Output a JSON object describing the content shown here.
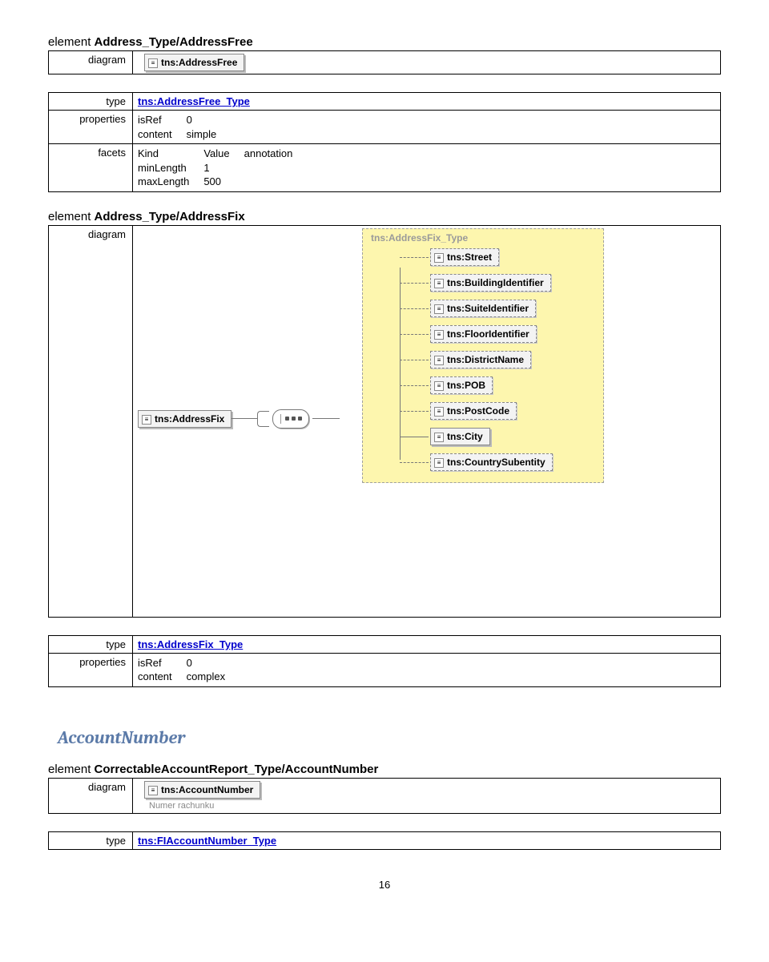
{
  "sections": {
    "addressFree": {
      "title_prefix": "element ",
      "title_bold": "Address_Type/AddressFree",
      "rows": {
        "diagram_label": "diagram",
        "diagram_elem": "tns:AddressFree",
        "type_label": "type",
        "type_link": "tns:AddressFree_Type",
        "props_label": "properties",
        "props": {
          "isRef_k": "isRef",
          "isRef_v": "0",
          "content_k": "content",
          "content_v": "simple"
        },
        "facets_label": "facets",
        "facets_head": {
          "c1": "Kind",
          "c2": "Value",
          "c3": "annotation"
        },
        "facets_rows": [
          {
            "c1": "minLength",
            "c2": "1"
          },
          {
            "c1": "maxLength",
            "c2": "500"
          }
        ]
      }
    },
    "addressFix": {
      "title_prefix": "element ",
      "title_bold": "Address_Type/AddressFix",
      "diagram_label": "diagram",
      "root_elem": "tns:AddressFix",
      "panel_title": "tns:AddressFix_Type",
      "children": [
        {
          "label": "tns:Street",
          "optional": true
        },
        {
          "label": "tns:BuildingIdentifier",
          "optional": true
        },
        {
          "label": "tns:SuiteIdentifier",
          "optional": true
        },
        {
          "label": "tns:FloorIdentifier",
          "optional": true
        },
        {
          "label": "tns:DistrictName",
          "optional": true
        },
        {
          "label": "tns:POB",
          "optional": true
        },
        {
          "label": "tns:PostCode",
          "optional": true
        },
        {
          "label": "tns:City",
          "optional": false
        },
        {
          "label": "tns:CountrySubentity",
          "optional": true
        }
      ],
      "type_label": "type",
      "type_link": "tns:AddressFix_Type",
      "props_label": "properties",
      "props": {
        "isRef_k": "isRef",
        "isRef_v": "0",
        "content_k": "content",
        "content_v": "complex"
      }
    },
    "accountNumber": {
      "heading": "AccountNumber",
      "title_prefix": "element ",
      "title_bold": "CorrectableAccountReport_Type/AccountNumber",
      "diagram_label": "diagram",
      "diagram_elem": "tns:AccountNumber",
      "caption": "Numer rachunku",
      "type_label": "type",
      "type_link": "tns:FIAccountNumber_Type"
    }
  },
  "page_number": "16"
}
